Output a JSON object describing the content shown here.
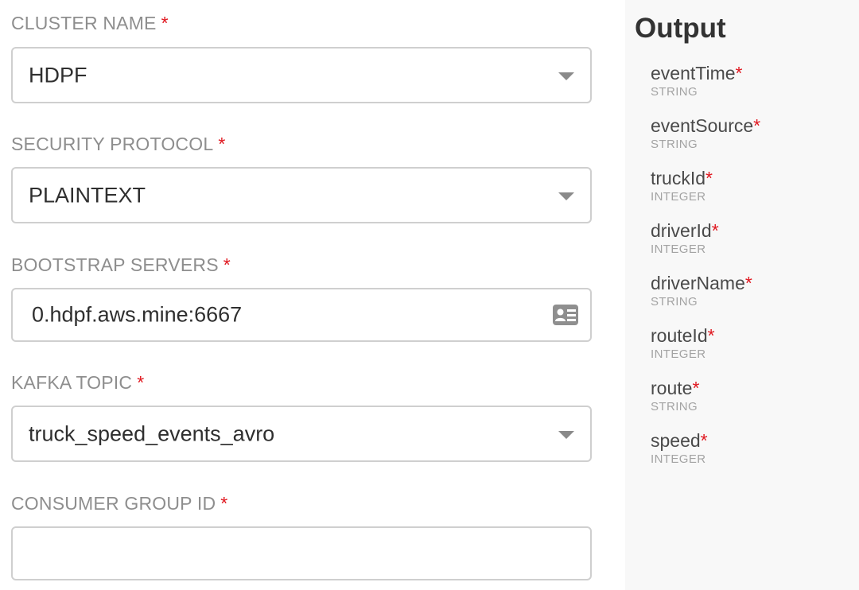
{
  "form": {
    "required_marker": "*",
    "cluster_name": {
      "label": "CLUSTER NAME",
      "value": "HDPF"
    },
    "security_protocol": {
      "label": "SECURITY PROTOCOL",
      "value": "PLAINTEXT"
    },
    "bootstrap_servers": {
      "label": "BOOTSTRAP SERVERS",
      "value": "0.hdpf.aws.mine:6667",
      "icon": "contact-card-icon"
    },
    "kafka_topic": {
      "label": "KAFKA TOPIC",
      "value": "truck_speed_events_avro"
    },
    "consumer_group_id": {
      "label": "CONSUMER GROUP ID",
      "value": ""
    }
  },
  "output": {
    "title": "Output",
    "fields": [
      {
        "name": "eventTime",
        "type": "STRING"
      },
      {
        "name": "eventSource",
        "type": "STRING"
      },
      {
        "name": "truckId",
        "type": "INTEGER"
      },
      {
        "name": "driverId",
        "type": "INTEGER"
      },
      {
        "name": "driverName",
        "type": "STRING"
      },
      {
        "name": "routeId",
        "type": "INTEGER"
      },
      {
        "name": "route",
        "type": "STRING"
      },
      {
        "name": "speed",
        "type": "INTEGER"
      }
    ]
  },
  "colors": {
    "required": "#e0171f",
    "label": "#8e8e8e",
    "border": "#cfcfcf",
    "panel_bg": "#f8f8f8"
  }
}
